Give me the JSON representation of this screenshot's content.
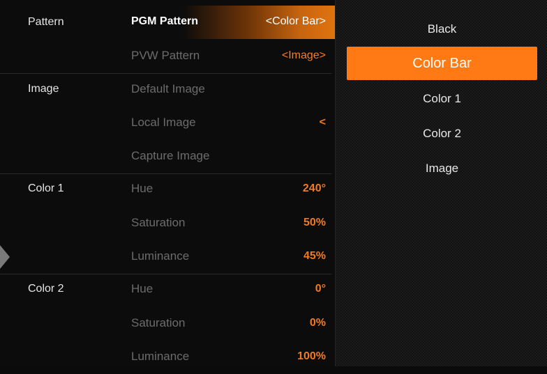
{
  "sections": {
    "pattern": "Pattern",
    "image": "Image",
    "color1": "Color 1",
    "color2": "Color 2"
  },
  "rows": {
    "pgm_pattern": {
      "label": "PGM Pattern",
      "value": "<Color Bar>"
    },
    "pvw_pattern": {
      "label": "PVW Pattern",
      "value": "<Image>"
    },
    "default_image": {
      "label": "Default Image",
      "value": ""
    },
    "local_image": {
      "label": "Local Image",
      "value": "<"
    },
    "capture_image": {
      "label": "Capture Image",
      "value": ""
    },
    "color1_hue": {
      "label": "Hue",
      "value": "240°"
    },
    "color1_saturation": {
      "label": "Saturation",
      "value": "50%"
    },
    "color1_luminance": {
      "label": "Luminance",
      "value": "45%"
    },
    "color2_hue": {
      "label": "Hue",
      "value": "0°"
    },
    "color2_saturation": {
      "label": "Saturation",
      "value": "0%"
    },
    "color2_luminance": {
      "label": "Luminance",
      "value": "100%"
    }
  },
  "options": [
    {
      "label": "Black",
      "selected": false
    },
    {
      "label": "Color Bar",
      "selected": true
    },
    {
      "label": "Color 1",
      "selected": false
    },
    {
      "label": "Color 2",
      "selected": false
    },
    {
      "label": "Image",
      "selected": false
    }
  ],
  "colors": {
    "accent": "#ff7a14",
    "value_text": "#ee7b22",
    "dim_text": "#6c6c6c"
  }
}
